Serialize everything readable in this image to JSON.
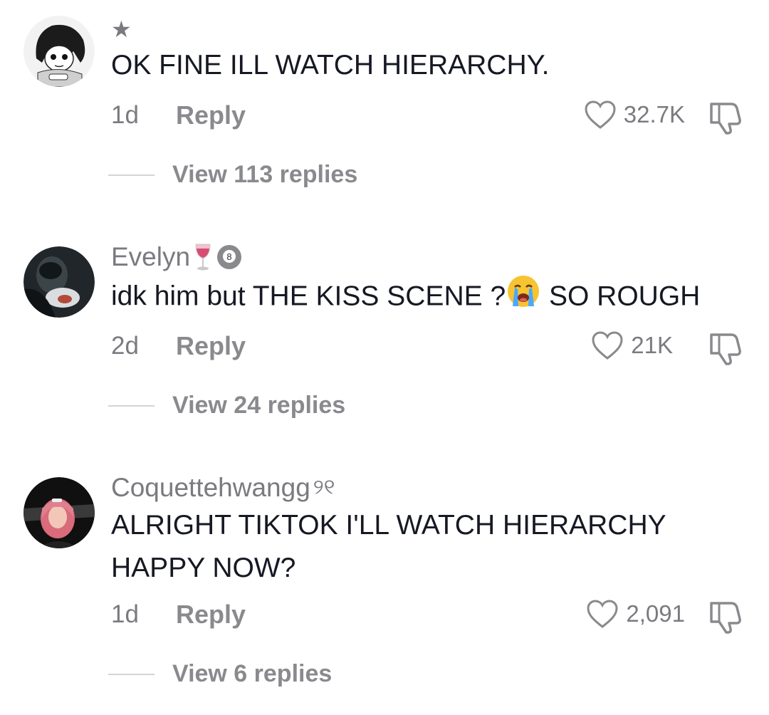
{
  "comments": [
    {
      "username": "★",
      "text": "OK FINE ILL WATCH HIERARCHY.",
      "time": "1d",
      "reply_label": "Reply",
      "likes": "32.7K",
      "view_replies": "View 113 replies",
      "avatar_icon": "manga-character-avatar"
    },
    {
      "username": "Evelyn",
      "username_badges": [
        "wine-glass-emoji",
        "pool-8-ball-emoji"
      ],
      "text_before": "idk him but THE KISS SCENE ?",
      "text_emoji": "loudly-crying-face-emoji",
      "text_after": " SO ROUGH",
      "time": "2d",
      "reply_label": "Reply",
      "likes": "21K",
      "view_replies": "View 24 replies",
      "avatar_icon": "dark-photo-avatar"
    },
    {
      "username": "Coquettehwangg",
      "username_suffix": "୨୧",
      "text_line1": "ALRIGHT TIKTOK I'LL WATCH HIERARCHY",
      "text_line2": "HAPPY NOW?",
      "time": "1d",
      "reply_label": "Reply",
      "likes": "2,091",
      "view_replies": "View 6 replies",
      "avatar_icon": "pink-hair-photo-avatar"
    }
  ],
  "colors": {
    "text": "#161823",
    "secondary": "#7a7a80",
    "divider": "#d4d4d6"
  }
}
